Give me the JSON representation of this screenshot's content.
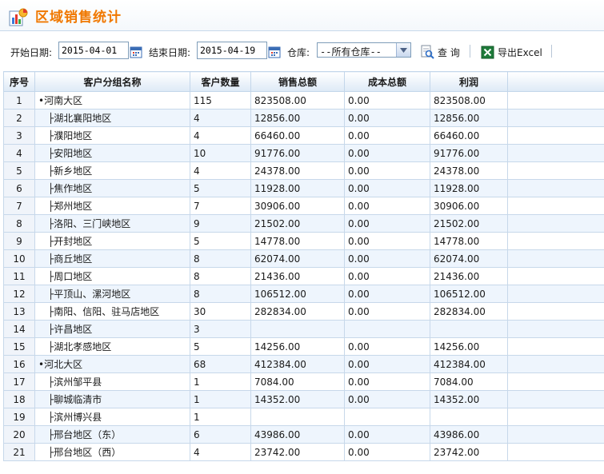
{
  "header": {
    "title": "区域销售统计"
  },
  "toolbar": {
    "start_label": "开始日期:",
    "start_value": "2015-04-01",
    "end_label": "结束日期:",
    "end_value": "2015-04-19",
    "warehouse_label": "仓库:",
    "warehouse_value": "--所有仓库--",
    "query_label": "查 询",
    "export_label": "导出Excel"
  },
  "table": {
    "columns": [
      "序号",
      "客户分组名称",
      "客户数量",
      "销售总额",
      "成本总额",
      "利润"
    ],
    "rows": [
      {
        "no": "1",
        "name": "•河南大区",
        "count": "115",
        "sales": "823508.00",
        "cost": "0.00",
        "profit": "823508.00",
        "level": 0
      },
      {
        "no": "2",
        "name": "├湖北襄阳地区",
        "count": "4",
        "sales": "12856.00",
        "cost": "0.00",
        "profit": "12856.00",
        "level": 1
      },
      {
        "no": "3",
        "name": "├濮阳地区",
        "count": "4",
        "sales": "66460.00",
        "cost": "0.00",
        "profit": "66460.00",
        "level": 1
      },
      {
        "no": "4",
        "name": "├安阳地区",
        "count": "10",
        "sales": "91776.00",
        "cost": "0.00",
        "profit": "91776.00",
        "level": 1
      },
      {
        "no": "5",
        "name": "├新乡地区",
        "count": "4",
        "sales": "24378.00",
        "cost": "0.00",
        "profit": "24378.00",
        "level": 1
      },
      {
        "no": "6",
        "name": "├焦作地区",
        "count": "5",
        "sales": "11928.00",
        "cost": "0.00",
        "profit": "11928.00",
        "level": 1
      },
      {
        "no": "7",
        "name": "├郑州地区",
        "count": "7",
        "sales": "30906.00",
        "cost": "0.00",
        "profit": "30906.00",
        "level": 1
      },
      {
        "no": "8",
        "name": "├洛阳、三门峡地区",
        "count": "9",
        "sales": "21502.00",
        "cost": "0.00",
        "profit": "21502.00",
        "level": 1
      },
      {
        "no": "9",
        "name": "├开封地区",
        "count": "5",
        "sales": "14778.00",
        "cost": "0.00",
        "profit": "14778.00",
        "level": 1
      },
      {
        "no": "10",
        "name": "├商丘地区",
        "count": "8",
        "sales": "62074.00",
        "cost": "0.00",
        "profit": "62074.00",
        "level": 1
      },
      {
        "no": "11",
        "name": "├周口地区",
        "count": "8",
        "sales": "21436.00",
        "cost": "0.00",
        "profit": "21436.00",
        "level": 1
      },
      {
        "no": "12",
        "name": "├平顶山、漯河地区",
        "count": "8",
        "sales": "106512.00",
        "cost": "0.00",
        "profit": "106512.00",
        "level": 1
      },
      {
        "no": "13",
        "name": "├南阳、信阳、驻马店地区",
        "count": "30",
        "sales": "282834.00",
        "cost": "0.00",
        "profit": "282834.00",
        "level": 1
      },
      {
        "no": "14",
        "name": "├许昌地区",
        "count": "3",
        "sales": "",
        "cost": "",
        "profit": "",
        "level": 1
      },
      {
        "no": "15",
        "name": "├湖北孝感地区",
        "count": "5",
        "sales": "14256.00",
        "cost": "0.00",
        "profit": "14256.00",
        "level": 1
      },
      {
        "no": "16",
        "name": "•河北大区",
        "count": "68",
        "sales": "412384.00",
        "cost": "0.00",
        "profit": "412384.00",
        "level": 0
      },
      {
        "no": "17",
        "name": "├滨州邹平县",
        "count": "1",
        "sales": "7084.00",
        "cost": "0.00",
        "profit": "7084.00",
        "level": 1
      },
      {
        "no": "18",
        "name": "├聊城临清市",
        "count": "1",
        "sales": "14352.00",
        "cost": "0.00",
        "profit": "14352.00",
        "level": 1
      },
      {
        "no": "19",
        "name": "├滨州博兴县",
        "count": "1",
        "sales": "",
        "cost": "",
        "profit": "",
        "level": 1
      },
      {
        "no": "20",
        "name": "├邢台地区（东）",
        "count": "6",
        "sales": "43986.00",
        "cost": "0.00",
        "profit": "43986.00",
        "level": 1
      },
      {
        "no": "21",
        "name": "├邢台地区（西）",
        "count": "4",
        "sales": "23742.00",
        "cost": "0.00",
        "profit": "23742.00",
        "level": 1
      }
    ]
  },
  "colors": {
    "title": "#f07800",
    "grid_border": "#c7d8ea",
    "row_alt": "#eef5fd"
  }
}
